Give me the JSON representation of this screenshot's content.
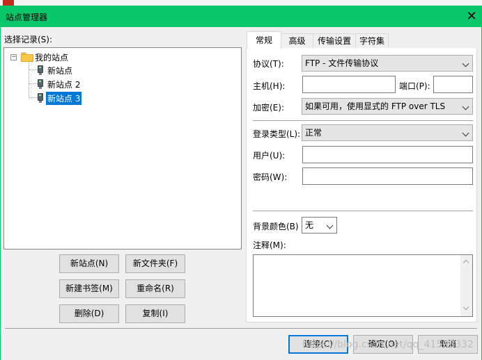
{
  "window": {
    "title": "站点管理器",
    "close_glyph": "✕"
  },
  "left": {
    "select_label": "选择记录(S):",
    "tree": {
      "root": {
        "label": "我的站点",
        "expander": "−"
      },
      "items": [
        {
          "label": "新站点"
        },
        {
          "label": "新站点 2"
        },
        {
          "label": "新站点 3",
          "selected": true
        }
      ]
    },
    "buttons": {
      "new_site": "新站点(N)",
      "new_folder": "新文件夹(F)",
      "new_bookmark": "新建书签(M)",
      "rename": "重命名(R)",
      "delete": "删除(D)",
      "copy": "复制(I)"
    }
  },
  "tabs": [
    {
      "label": "常规",
      "active": true
    },
    {
      "label": "高级"
    },
    {
      "label": "传输设置"
    },
    {
      "label": "字符集"
    }
  ],
  "general": {
    "protocol": {
      "label": "协议(T):",
      "value": "FTP - 文件传输协议"
    },
    "host": {
      "label": "主机(H):",
      "value": ""
    },
    "port": {
      "label": "端口(P):",
      "value": ""
    },
    "encryption": {
      "label": "加密(E):",
      "value": "如果可用，使用显式的 FTP over TLS"
    },
    "logon_type": {
      "label": "登录类型(L):",
      "value": "正常"
    },
    "user": {
      "label": "用户(U):",
      "value": ""
    },
    "password": {
      "label": "密码(W):",
      "value": ""
    },
    "bg_color": {
      "label": "背景颜色(B)",
      "value": "无"
    },
    "comments": {
      "label": "注释(M):",
      "value": ""
    }
  },
  "footer": {
    "connect": "连接(C)",
    "ok": "确定(O)",
    "cancel": "取消",
    "watermark": "https://blog.csdn.net/qq_41593332"
  },
  "colors": {
    "title_bar": "#0bc76c",
    "selection": "#0078d7"
  }
}
